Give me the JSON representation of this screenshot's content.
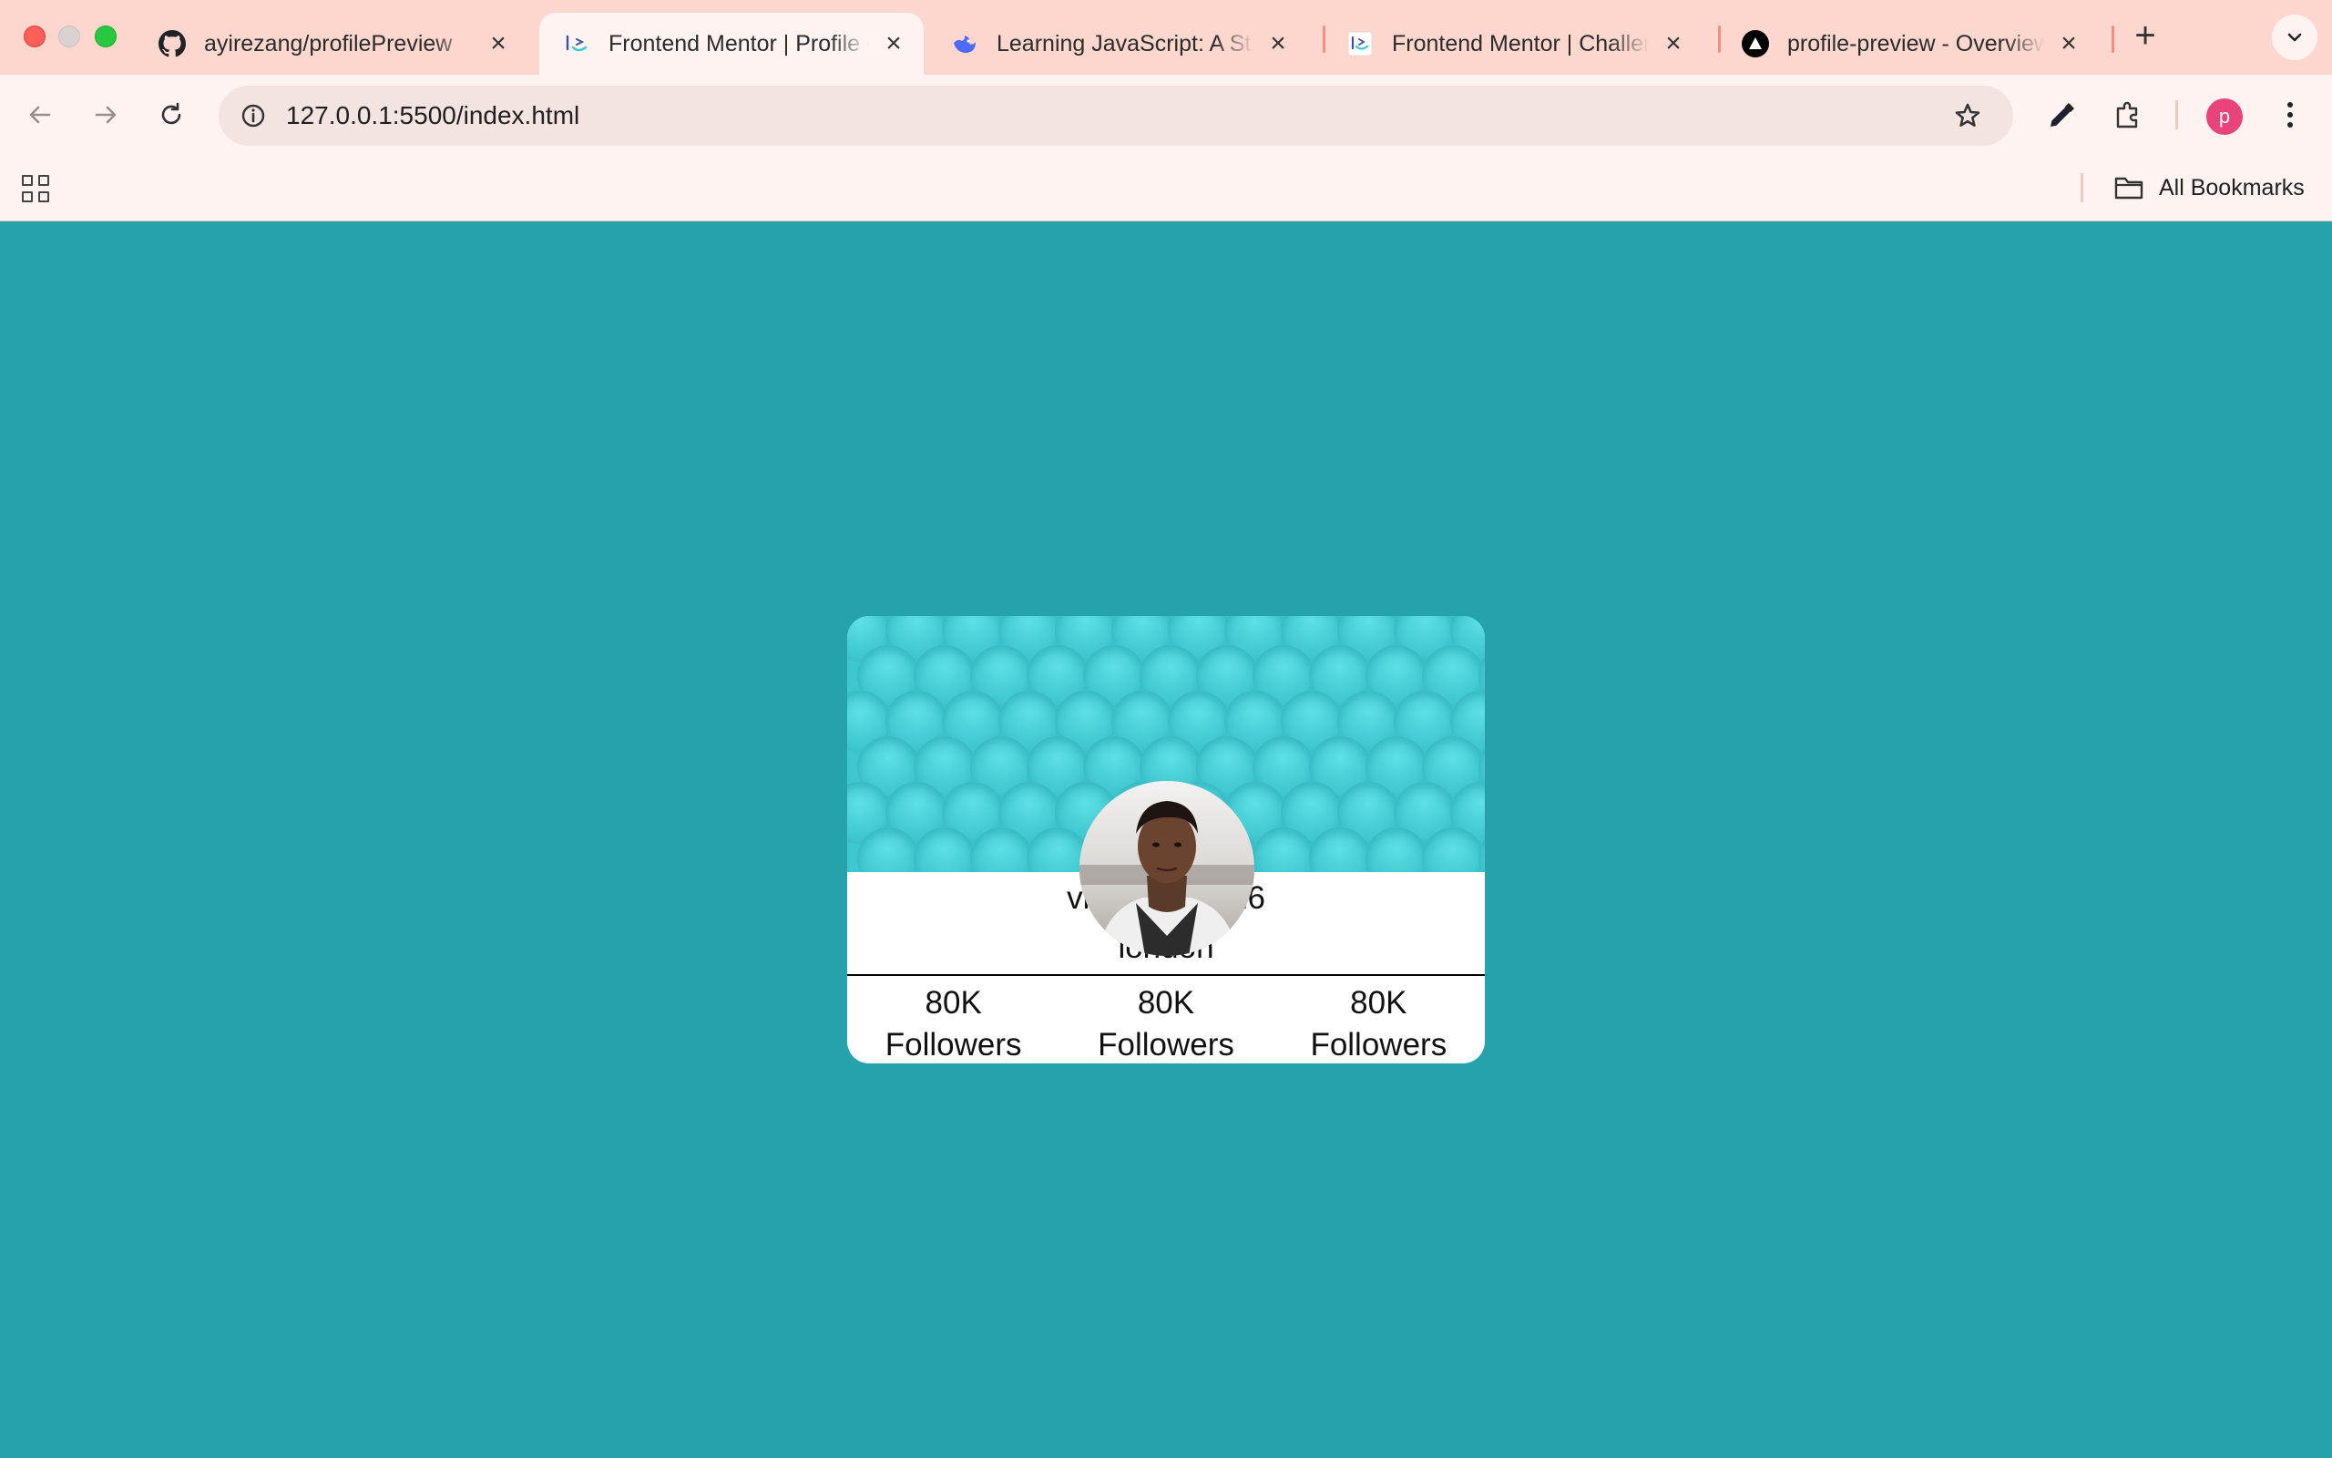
{
  "browser": {
    "tabs": [
      {
        "title": "ayirezang/profilePreview",
        "favicon": "github-icon",
        "active": false
      },
      {
        "title": "Frontend Mentor | Profile card component",
        "favicon": "frontend-mentor-icon",
        "active": true
      },
      {
        "title": "Learning JavaScript: A Structured Path",
        "favicon": "deepseek-icon",
        "active": false
      },
      {
        "title": "Frontend Mentor | Challenges",
        "favicon": "frontend-mentor-icon",
        "active": false
      },
      {
        "title": "profile-preview - Overview",
        "favicon": "vercel-icon",
        "active": false
      }
    ],
    "url": "127.0.0.1:5500/index.html",
    "profile_initial": "p",
    "profile_color": "#e8437b",
    "bookmarks_label": "All Bookmarks",
    "tabstrip_color": "#fdd6cd",
    "toolbar_color": "#fef3f1"
  },
  "page": {
    "background": "#26a2ad",
    "card": {
      "header_color": "#3fc7cf",
      "name": "victor crest 26",
      "location": "london",
      "stats": [
        {
          "value": "80K",
          "label": "Followers"
        },
        {
          "value": "80K",
          "label": "Followers"
        },
        {
          "value": "80K",
          "label": "Followers"
        }
      ]
    }
  }
}
